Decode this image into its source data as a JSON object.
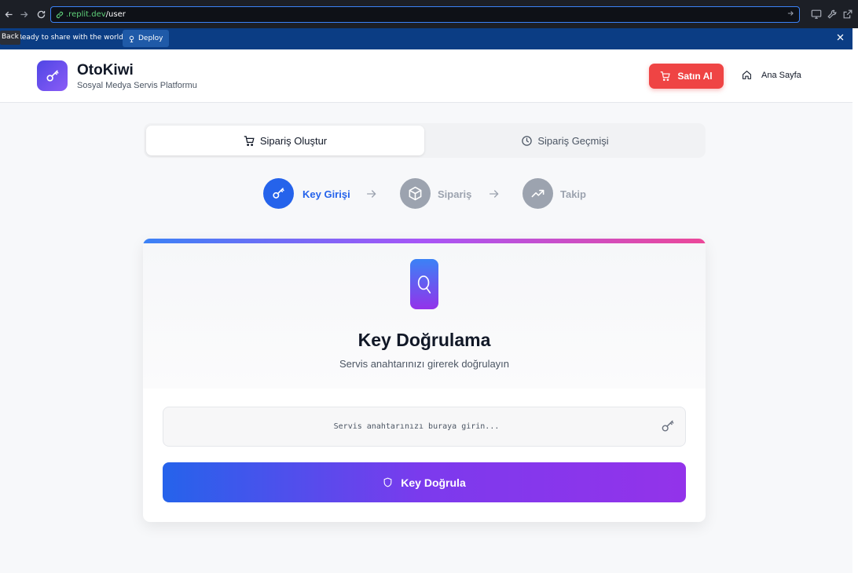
{
  "browser": {
    "url_domain": ".replit.dev",
    "url_path": "/user"
  },
  "replit_bar": {
    "back_tooltip": "Back",
    "prompt": "Ready to share with the world?",
    "deploy_label": "Deploy"
  },
  "header": {
    "brand": "OtoKiwi",
    "subtitle": "Sosyal Medya Servis Platformu",
    "buy_label": "Satın Al",
    "home_label": "Ana Sayfa"
  },
  "tabs": [
    {
      "label": "Sipariş Oluştur",
      "active": true,
      "icon": "cart-icon"
    },
    {
      "label": "Sipariş Geçmişi",
      "active": false,
      "icon": "clock-icon"
    }
  ],
  "steps": [
    {
      "label": "Key Girişi",
      "active": true,
      "icon": "key-icon"
    },
    {
      "label": "Sipariş",
      "active": false,
      "icon": "box-icon"
    },
    {
      "label": "Takip",
      "active": false,
      "icon": "trending-up-icon"
    }
  ],
  "card": {
    "title": "Key Doğrulama",
    "subtitle": "Servis anahtarınızı girerek doğrulayın",
    "input_placeholder": "Servis anahtarınızı buraya girin...",
    "input_value": "",
    "button_label": "Key Doğrula"
  },
  "colors": {
    "accent_blue": "#2563eb",
    "accent_purple": "#9333ea",
    "buy_red": "#ef4444",
    "step_active_text": "#2563eb",
    "step_inactive_circle": "#9ca3af"
  }
}
